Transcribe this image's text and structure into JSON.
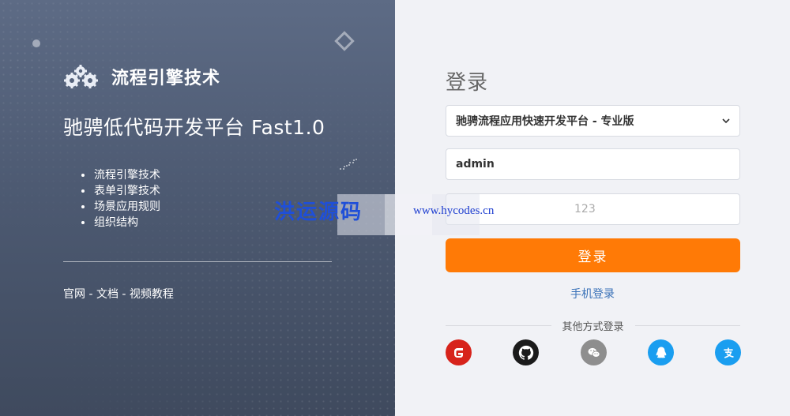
{
  "left": {
    "brand_name": "流程引擎技术",
    "platform_title": "驰骋低代码开发平台 Fast1.0",
    "features": [
      "流程引擎技术",
      "表单引擎技术",
      "场景应用规则",
      "组织结构"
    ],
    "links": {
      "official": "官网",
      "docs": "文档",
      "video": "视频教程",
      "sep": " - "
    }
  },
  "right": {
    "heading": "登录",
    "edition_select": "驰骋流程应用快速开发平台 - 专业版",
    "username_value": "admin",
    "password_value": "123",
    "submit_label": "登录",
    "phone_login": "手机登录",
    "other_methods": "其他方式登录",
    "social": [
      "gitee-icon",
      "github-icon",
      "wechat-icon",
      "qq-icon",
      "alipay-icon"
    ]
  },
  "watermark": {
    "cn": "洪运源码",
    "url": "www.hycodes.cn"
  },
  "colors": {
    "accent": "#ff7a06",
    "link": "#3a72b8",
    "left_panel": "#4d5a72"
  }
}
